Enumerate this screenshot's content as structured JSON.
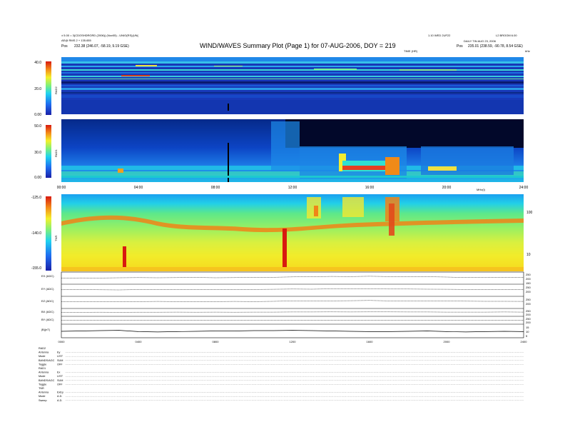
{
  "header": {
    "left_line1": "± 5.00 = 3(CDOSHDRGRD (2006)) (Nov05) - UNIO(RS)(UN(",
    "left_line2": "AE@ RMS 2 + 135.655",
    "left_pos_label": "Pos",
    "left_pos_value": "232.38 (246.07, -58.19, 9.19 GSE)",
    "title": "WIND/WAVES Summary Plot (Page 1) for 07-AUG-2006, DOY = 219",
    "right_line1": "1.10 WED 2UF22",
    "right_line1b": "L2 BROOM 6.00",
    "right_line2": "DAILY TIN AUG 23, 2006",
    "right_pos_label": "Pos",
    "right_pos_value": "235.01 (238.59, -90.78, 8.54 GSE)",
    "time_label": "TIME (HR)",
    "khz_label": "kHz",
    "mhz_label": "MHz(I)"
  },
  "chart_data": [
    {
      "type": "heatmap",
      "panel": "RAD2",
      "colorbar_ticks": [
        "40.0",
        "20.0",
        "0.00"
      ],
      "colorbar_range": [
        0,
        40
      ],
      "panel_label": "RAD2"
    },
    {
      "type": "heatmap",
      "panel": "RAD1",
      "colorbar_ticks": [
        "50.0",
        "30.0",
        "0.00"
      ],
      "colorbar_range": [
        0,
        50
      ],
      "panel_label": "RAD1",
      "x_ticks": [
        "00:00",
        "04:00",
        "08:00",
        "12:00",
        "16:00",
        "20:00",
        "24:00"
      ],
      "x_range_hours": [
        0,
        24
      ]
    },
    {
      "type": "heatmap",
      "panel": "TNR",
      "colorbar_ticks": [
        "-125.0",
        "-140.0",
        "-155.0"
      ],
      "colorbar_range": [
        -155,
        -125
      ],
      "panel_label": "TNR",
      "right_axis_ticks": [
        "100",
        "10"
      ],
      "right_axis_label": "kHz"
    },
    {
      "type": "line",
      "panel": "EX(ADC)",
      "label": "EX (ADC)",
      "right_ticks": [
        "250",
        "200",
        "150"
      ],
      "x": [
        0,
        1,
        2,
        3,
        4,
        5,
        6,
        7,
        8,
        9,
        10,
        11,
        12,
        13,
        14,
        15,
        16,
        17,
        18,
        19,
        20,
        21,
        22,
        23,
        24
      ],
      "y": [
        200,
        202,
        201,
        203,
        204,
        203,
        204,
        205,
        203,
        204,
        206,
        207,
        210,
        212,
        214,
        213,
        215,
        213,
        212,
        211,
        209,
        205,
        204,
        206,
        205
      ]
    },
    {
      "type": "line",
      "panel": "EY(ADC)",
      "label": "EY (ADC)",
      "right_ticks": [
        "250",
        "200"
      ],
      "x": [
        0,
        1,
        2,
        3,
        4,
        5,
        6,
        7,
        8,
        9,
        10,
        11,
        12,
        13,
        14,
        15,
        16,
        17,
        18,
        19,
        20,
        21,
        22,
        23,
        24
      ],
      "y": [
        204,
        205,
        204,
        203,
        205,
        206,
        205,
        206,
        205,
        206,
        207,
        208,
        210,
        209,
        211,
        212,
        211,
        210,
        210,
        209,
        208,
        207,
        206,
        207,
        206
      ]
    },
    {
      "type": "line",
      "panel": "EZ(ADC)",
      "label": "EZ (ADC)",
      "right_ticks": [
        "250",
        "200"
      ],
      "x": [
        0,
        1,
        2,
        3,
        4,
        5,
        6,
        7,
        8,
        9,
        10,
        11,
        12,
        13,
        14,
        15,
        16,
        17,
        18,
        19,
        20,
        21,
        22,
        23,
        24
      ],
      "y": [
        206,
        206,
        205,
        206,
        207,
        208,
        207,
        206,
        207,
        208,
        207,
        209,
        212,
        211,
        213,
        214,
        216,
        213,
        212,
        211,
        211,
        210,
        209,
        209,
        208
      ]
    },
    {
      "type": "line",
      "panel": "BX(ADC)",
      "label": "BX (ADC)",
      "right_ticks": [
        "250",
        "200"
      ],
      "x": [
        0,
        1,
        2,
        3,
        4,
        5,
        6,
        7,
        8,
        9,
        10,
        11,
        12,
        13,
        14,
        15,
        16,
        17,
        18,
        19,
        20,
        21,
        22,
        23,
        24
      ],
      "y": [
        202,
        202,
        203,
        202,
        203,
        203,
        204,
        203,
        204,
        203,
        204,
        204,
        205,
        205,
        206,
        205,
        206,
        206,
        205,
        205,
        204,
        204,
        204,
        205,
        204
      ]
    },
    {
      "type": "line",
      "panel": "BY(ADC)",
      "label": "BY (ADC)",
      "right_ticks": [
        "250",
        "200"
      ],
      "x": [
        0,
        1,
        2,
        3,
        4,
        5,
        6,
        7,
        8,
        9,
        10,
        11,
        12,
        13,
        14,
        15,
        16,
        17,
        18,
        19,
        20,
        21,
        22,
        23,
        24
      ],
      "y": [
        199,
        199,
        199,
        200,
        200,
        200,
        200,
        200,
        201,
        200,
        201,
        201,
        202,
        202,
        202,
        201,
        202,
        202,
        201,
        201,
        201,
        201,
        200,
        201,
        201
      ]
    },
    {
      "type": "line",
      "panel": "|B|(nT)",
      "label": "|B|(nT)",
      "right_ticks": [
        "15",
        "10",
        "5"
      ],
      "x": [
        0,
        1,
        2,
        3,
        4,
        5,
        6,
        7,
        8,
        9,
        10,
        11,
        12,
        13,
        14,
        15,
        16,
        17,
        18,
        19,
        20,
        21,
        22,
        23,
        24
      ],
      "y": [
        9.5,
        10,
        10.5,
        11,
        9,
        8.5,
        9,
        9.5,
        10,
        10,
        10.5,
        10.5,
        11,
        10.5,
        10,
        9.5,
        9,
        9,
        9.5,
        10,
        9,
        8.5,
        9,
        9.5,
        9
      ],
      "x_ticks": [
        "0000",
        "0400",
        "0800",
        "1200",
        "1600",
        "2000",
        "2400"
      ]
    }
  ],
  "footer_rows": [
    {
      "k": "RAD2",
      "v": ""
    },
    {
      "k": "Antenna",
      "v": "Ey"
    },
    {
      "k": "Mode",
      "v": "LIST"
    },
    {
      "k": "BANDS/AGC",
      "v": "SUM"
    },
    {
      "k": "Toggle",
      "v": "OFF"
    },
    {
      "k": "RAD1",
      "v": ""
    },
    {
      "k": "Antenna",
      "v": "Ex"
    },
    {
      "k": "Mode",
      "v": "LIST"
    },
    {
      "k": "BANDS/AGC",
      "v": "SUM"
    },
    {
      "k": "Toggle",
      "v": "OFF"
    },
    {
      "k": "TNR",
      "v": ""
    },
    {
      "k": "Antenna",
      "v": "ExEy"
    },
    {
      "k": "Mode",
      "v": "A.D."
    },
    {
      "k": "Sweep",
      "v": "A.D."
    }
  ]
}
